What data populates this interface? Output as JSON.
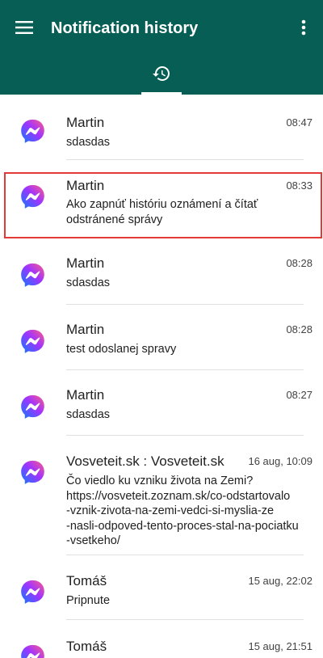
{
  "header": {
    "title": "Notification history",
    "menu_icon": "hamburger-menu-icon",
    "more_icon": "more-vert-icon",
    "tab_icon": "history-icon"
  },
  "colors": {
    "appbar": "#075e54",
    "highlight": "#e53935",
    "messenger_gradient_start": "#0a7cff",
    "messenger_gradient_end": "#ff5c87"
  },
  "notifications": [
    {
      "app_icon": "messenger-icon",
      "title": "Martin",
      "time": "08:47",
      "text": "sdasdas"
    },
    {
      "app_icon": "messenger-icon",
      "title": "Martin",
      "time": "08:33",
      "text": "Ako zapnúť históriu oznámení a čítať odstránené správy",
      "highlighted": true
    },
    {
      "app_icon": "messenger-icon",
      "title": "Martin",
      "time": "08:28",
      "text": "sdasdas"
    },
    {
      "app_icon": "messenger-icon",
      "title": "Martin",
      "time": "08:28",
      "text": "test odoslanej spravy"
    },
    {
      "app_icon": "messenger-icon",
      "title": "Martin",
      "time": "08:27",
      "text": "sdasdas"
    },
    {
      "app_icon": "messenger-icon",
      "title": "Vosveteit.sk : Vosveteit.sk",
      "time": "16 aug, 10:09",
      "text": "Čo viedlo ku vzniku života na Zemi?\nhttps://vosveteit.zoznam.sk/co-odstartovalo\n-vznik-zivota-na-zemi-vedci-si-myslia-ze\n-nasli-odpoved-tento-proces-stal-na-pociatku\n-vsetkeho/"
    },
    {
      "app_icon": "messenger-icon",
      "title": "Tomáš",
      "time": "15 aug, 22:02",
      "text": "Pripnute"
    },
    {
      "app_icon": "messenger-icon",
      "title": "Tomáš",
      "time": "15 aug, 21:51",
      "text": ""
    }
  ]
}
